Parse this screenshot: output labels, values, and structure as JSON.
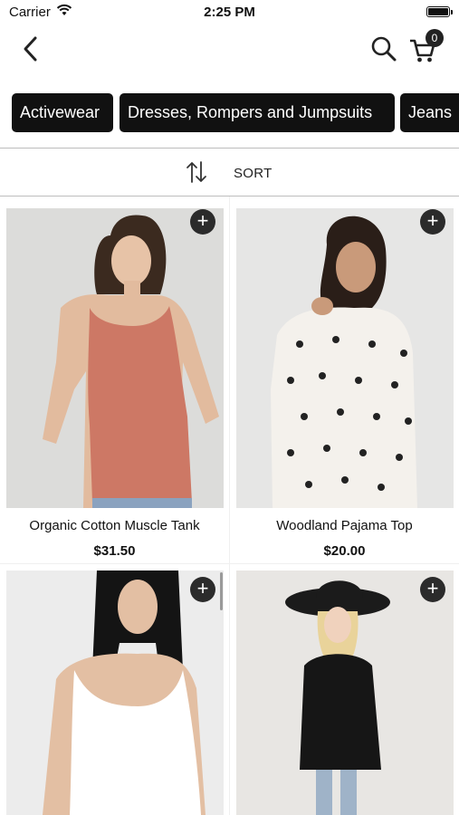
{
  "status_bar": {
    "carrier": "Carrier",
    "time": "2:25 PM"
  },
  "nav": {
    "cart_count": "0",
    "icons": [
      "back-chevron-icon",
      "search-icon",
      "cart-icon"
    ]
  },
  "categories": [
    {
      "label": "Activewear"
    },
    {
      "label": "Dresses, Rompers and Jumpsuits"
    },
    {
      "label": "Jeans"
    }
  ],
  "sort": {
    "label": "SORT",
    "icon": "sort-arrows-icon"
  },
  "products": [
    {
      "name": "Organic Cotton Muscle Tank",
      "price": "$31.50",
      "image": "woman-terracotta-tank-photo"
    },
    {
      "name": "Woodland Pajama Top",
      "price": "$20.00",
      "image": "woman-white-print-top-photo"
    },
    {
      "name": "",
      "price": "",
      "image": "woman-white-tank-photo"
    },
    {
      "name": "",
      "price": "",
      "image": "woman-black-tunic-hat-photo"
    }
  ],
  "colors": {
    "chip_bg": "#111111",
    "add_button_bg": "#2b2b2b",
    "tank_color": "#cd7865"
  }
}
